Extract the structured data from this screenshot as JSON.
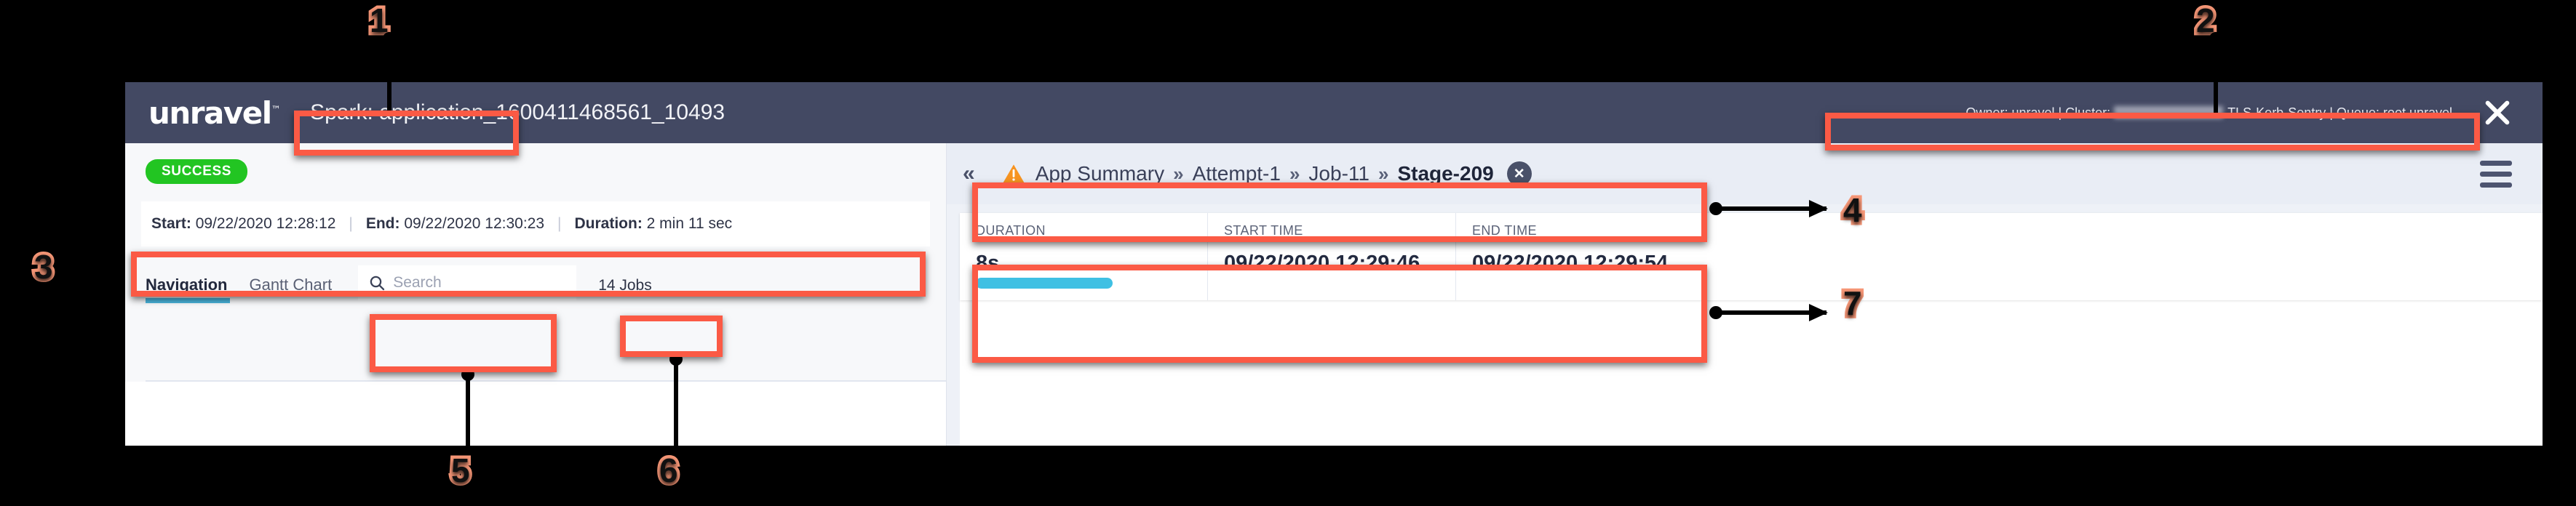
{
  "header": {
    "logo": "unravel",
    "logo_tm": "™",
    "app_title": "Spark:  application_1600411468561_10493",
    "meta_prefix": "Owner: unravel | Cluster: ",
    "meta_suffix": "-TLS-Kerb-Sentry | Queue: root.unravel",
    "close_icon": "close-icon"
  },
  "left_panel": {
    "status_badge": "SUCCESS",
    "start_label": "Start:",
    "start_value": "09/22/2020 12:28:12",
    "end_label": "End:",
    "end_value": "09/22/2020 12:30:23",
    "duration_label": "Duration:",
    "duration_value": "2 min 11 sec",
    "separator": "|",
    "tabs": [
      {
        "label": "Navigation",
        "active": true
      },
      {
        "label": "Gantt Chart",
        "active": false
      }
    ],
    "search_placeholder": "Search",
    "search_value": "",
    "jobs_count": "14 Jobs"
  },
  "right_panel": {
    "collapse_icon": "«",
    "warning_icon": "warning-icon",
    "breadcrumb": [
      {
        "label": "App Summary",
        "current": false
      },
      {
        "label": "Attempt-1",
        "current": false
      },
      {
        "label": "Job-11",
        "current": false
      },
      {
        "label": "Stage-209",
        "current": true
      }
    ],
    "breadcrumb_separator": "»",
    "breadcrumb_close": "✕",
    "menu_icon": "hamburger-menu-icon",
    "cards": [
      {
        "label": "DURATION",
        "value": "8s",
        "has_bar": true
      },
      {
        "label": "START TIME",
        "value": "09/22/2020 12:29:46",
        "has_bar": false
      },
      {
        "label": "END TIME",
        "value": "09/22/2020 12:29:54",
        "has_bar": false
      }
    ]
  },
  "annotations": {
    "color": "#f79777",
    "box_color": "#fb5a45",
    "markers": [
      "1",
      "2",
      "3",
      "4",
      "5",
      "6",
      "7"
    ]
  }
}
